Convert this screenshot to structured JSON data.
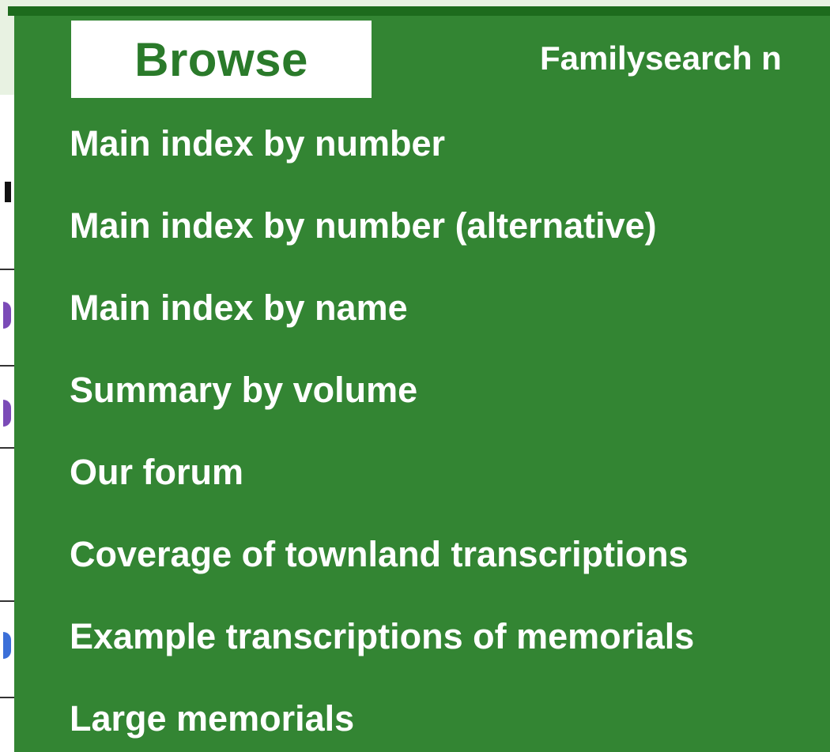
{
  "nav": {
    "active_tab": "Browse",
    "partial_link": "Familysearch n"
  },
  "menu": {
    "items": [
      {
        "label": "Main index by number"
      },
      {
        "label": "Main index by number (alternative)"
      },
      {
        "label": "Main index by name"
      },
      {
        "label": "Summary by volume"
      },
      {
        "label": "Our forum"
      },
      {
        "label": "Coverage of townland transcriptions"
      },
      {
        "label": "Example transcriptions of memorials"
      },
      {
        "label": "Large memorials"
      }
    ]
  },
  "colors": {
    "menu_bg": "#338533",
    "top_strip": "#1d6b1d",
    "tab_text": "#2a7a2a",
    "page_bg": "#e8f2e2"
  }
}
